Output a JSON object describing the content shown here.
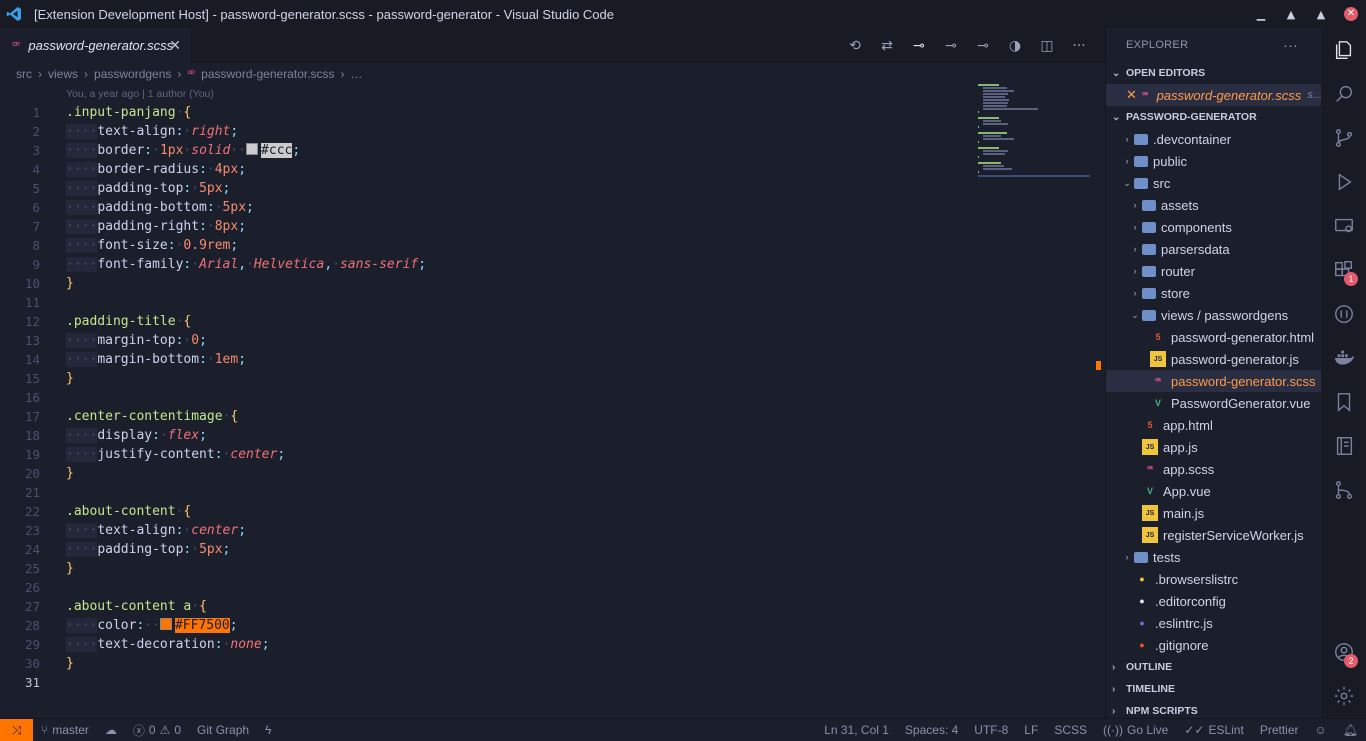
{
  "window": {
    "title": "[Extension Development Host] - password-generator.scss - password-generator - Visual Studio Code"
  },
  "tab": {
    "label": "password-generator.scss"
  },
  "breadcrumb": [
    "src",
    "views",
    "passwordgens",
    "password-generator.scss",
    "…"
  ],
  "blame": "You, a year ago | 1 author (You)",
  "code": {
    "lines": [
      {
        "n": "1",
        "text": ".input-panjang {"
      },
      {
        "n": "2",
        "text": "    text-align: right;"
      },
      {
        "n": "3",
        "text": "    border: 1px solid  #ccc;"
      },
      {
        "n": "4",
        "text": "    border-radius: 4px;"
      },
      {
        "n": "5",
        "text": "    padding-top: 5px;"
      },
      {
        "n": "6",
        "text": "    padding-bottom: 5px;"
      },
      {
        "n": "7",
        "text": "    padding-right: 8px;"
      },
      {
        "n": "8",
        "text": "    font-size: 0.9rem;"
      },
      {
        "n": "9",
        "text": "    font-family: Arial, Helvetica, sans-serif;"
      },
      {
        "n": "10",
        "text": "}"
      },
      {
        "n": "11",
        "text": ""
      },
      {
        "n": "12",
        "text": ".padding-title {"
      },
      {
        "n": "13",
        "text": "    margin-top: 0;"
      },
      {
        "n": "14",
        "text": "    margin-bottom: 1em;"
      },
      {
        "n": "15",
        "text": "}"
      },
      {
        "n": "16",
        "text": ""
      },
      {
        "n": "17",
        "text": ".center-contentimage {"
      },
      {
        "n": "18",
        "text": "    display: flex;"
      },
      {
        "n": "19",
        "text": "    justify-content: center;"
      },
      {
        "n": "20",
        "text": "}"
      },
      {
        "n": "21",
        "text": ""
      },
      {
        "n": "22",
        "text": ".about-content {"
      },
      {
        "n": "23",
        "text": "    text-align: center;"
      },
      {
        "n": "24",
        "text": "    padding-top: 5px;"
      },
      {
        "n": "25",
        "text": "}"
      },
      {
        "n": "26",
        "text": ""
      },
      {
        "n": "27",
        "text": ".about-content a {"
      },
      {
        "n": "28",
        "text": "    color:  #FF7500;"
      },
      {
        "n": "29",
        "text": "    text-decoration: none;"
      },
      {
        "n": "30",
        "text": "}"
      },
      {
        "n": "31",
        "text": ""
      }
    ]
  },
  "explorer": {
    "header": "EXPLORER",
    "more": "···",
    "open_editors_label": "OPEN EDITORS",
    "open_editor_file": "password-generator.scss",
    "open_editor_path": "s...",
    "project_label": "PASSWORD-GENERATOR",
    "tree": [
      {
        "label": ".devcontainer",
        "type": "folder",
        "depth": 1,
        "chev": "›",
        "icon": "folder-icon"
      },
      {
        "label": "public",
        "type": "folder",
        "depth": 1,
        "chev": "›",
        "icon": "folder-icon"
      },
      {
        "label": "src",
        "type": "folder-open",
        "depth": 1,
        "chev": "⌄",
        "icon": "folder-open-icon"
      },
      {
        "label": "assets",
        "type": "folder",
        "depth": 2,
        "chev": "›",
        "icon": "folder-icon"
      },
      {
        "label": "components",
        "type": "folder",
        "depth": 2,
        "chev": "›",
        "icon": "folder-icon"
      },
      {
        "label": "parsersdata",
        "type": "folder",
        "depth": 2,
        "chev": "›",
        "icon": "folder-icon"
      },
      {
        "label": "router",
        "type": "folder",
        "depth": 2,
        "chev": "›",
        "icon": "folder-icon"
      },
      {
        "label": "store",
        "type": "folder",
        "depth": 2,
        "chev": "›",
        "icon": "folder-icon"
      },
      {
        "label": "views / passwordgens",
        "type": "folder-open",
        "depth": 2,
        "chev": "⌄",
        "icon": "folder-open-icon"
      },
      {
        "label": "password-generator.html",
        "type": "html",
        "depth": 3,
        "chev": "",
        "icon": "html-file-icon"
      },
      {
        "label": "password-generator.js",
        "type": "js",
        "depth": 3,
        "chev": "",
        "icon": "js-file-icon"
      },
      {
        "label": "password-generator.scss",
        "type": "scss",
        "depth": 3,
        "chev": "",
        "icon": "scss-file-icon",
        "active": true
      },
      {
        "label": "PasswordGenerator.vue",
        "type": "vue",
        "depth": 3,
        "chev": "",
        "icon": "vue-file-icon"
      },
      {
        "label": "app.html",
        "type": "html",
        "depth": 2,
        "chev": "",
        "icon": "html-file-icon"
      },
      {
        "label": "app.js",
        "type": "js",
        "depth": 2,
        "chev": "",
        "icon": "js-file-icon"
      },
      {
        "label": "app.scss",
        "type": "scss",
        "depth": 2,
        "chev": "",
        "icon": "scss-file-icon"
      },
      {
        "label": "App.vue",
        "type": "vue",
        "depth": 2,
        "chev": "",
        "icon": "vue-file-icon"
      },
      {
        "label": "main.js",
        "type": "js",
        "depth": 2,
        "chev": "",
        "icon": "js-file-icon"
      },
      {
        "label": "registerServiceWorker.js",
        "type": "js",
        "depth": 2,
        "chev": "",
        "icon": "js-file-icon"
      },
      {
        "label": "tests",
        "type": "folder",
        "depth": 1,
        "chev": "›",
        "icon": "folder-icon"
      },
      {
        "label": ".browserslistrc",
        "type": "cfg",
        "depth": 1,
        "chev": "",
        "icon": "browserslist-icon"
      },
      {
        "label": ".editorconfig",
        "type": "cfg",
        "depth": 1,
        "chev": "",
        "icon": "editorconfig-icon"
      },
      {
        "label": ".eslintrc.js",
        "type": "cfg",
        "depth": 1,
        "chev": "",
        "icon": "eslint-icon"
      },
      {
        "label": ".gitignore",
        "type": "cfg",
        "depth": 1,
        "chev": "",
        "icon": "git-icon"
      }
    ],
    "sections": [
      "OUTLINE",
      "TIMELINE",
      "NPM SCRIPTS"
    ]
  },
  "activity": {
    "extensions_badge": "1",
    "accounts_badge": "2"
  },
  "status": {
    "branch": "master",
    "errors": "0",
    "warnings": "0",
    "git_graph": "Git Graph",
    "position": "Ln 31, Col 1",
    "spaces": "Spaces: 4",
    "encoding": "UTF-8",
    "eol": "LF",
    "language": "SCSS",
    "go_live": "Go Live",
    "eslint": "ESLint",
    "prettier": "Prettier"
  }
}
